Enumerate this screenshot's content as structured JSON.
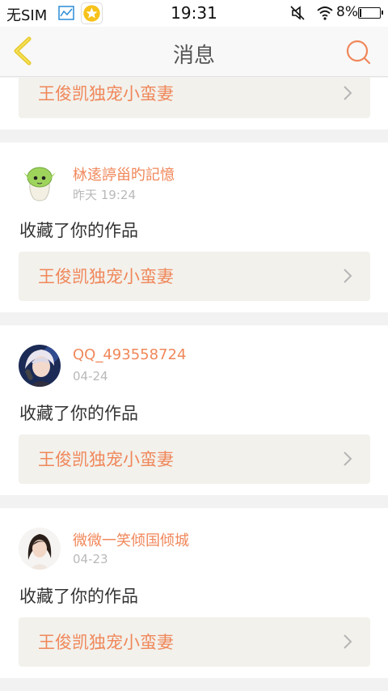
{
  "status_bar": {
    "carrier": "无SIM",
    "time": "19:31",
    "battery": "8%",
    "battery_level": 0.08
  },
  "header": {
    "title": "消息"
  },
  "colors": {
    "accent": "#f0875a",
    "header_icon": "#f2dc3a",
    "link_background": "#f2f1ec",
    "page_background": "#f2f2f2"
  },
  "partial_card": {
    "work_title": "王俊凯独宠小蛮妻"
  },
  "notifications": [
    {
      "user": "栤逺諪甾旳記憶",
      "time": "昨天 19:24",
      "message": "收藏了你的作品",
      "work_title": "王俊凯独宠小蛮妻",
      "avatar_icon": "green-mascot-avatar"
    },
    {
      "user": "QQ_493558724",
      "time": "04-24",
      "message": "收藏了你的作品",
      "work_title": "王俊凯独宠小蛮妻",
      "avatar_icon": "anime-singer-avatar"
    },
    {
      "user": "微微一笑倾国倾城",
      "time": "04-23",
      "message": "收藏了你的作品",
      "work_title": "王俊凯独宠小蛮妻",
      "avatar_icon": "girl-portrait-avatar"
    }
  ]
}
